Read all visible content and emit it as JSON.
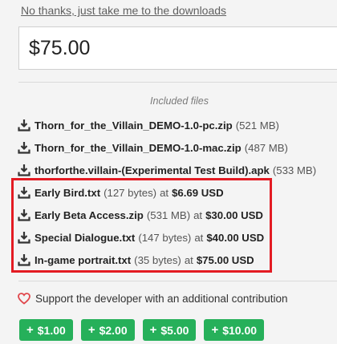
{
  "skip_link": "No thanks, just take me to the downloads",
  "price_input": {
    "value": "$75.00"
  },
  "files_heading": "Included files",
  "files": [
    {
      "name": "Thorn_for_the_Villain_DEMO-1.0-pc.zip",
      "size": "(521 MB)",
      "price_prefix": "",
      "price": ""
    },
    {
      "name": "Thorn_for_the_Villain_DEMO-1.0-mac.zip",
      "size": "(487 MB)",
      "price_prefix": "",
      "price": ""
    },
    {
      "name": "thorforthe.villain-(Experimental Test Build).apk",
      "size": "(533 MB)",
      "price_prefix": "",
      "price": ""
    },
    {
      "name": "Early Bird.txt",
      "size": "(127 bytes)",
      "price_prefix": "at",
      "price": "$6.69 USD"
    },
    {
      "name": "Early Beta Access.zip",
      "size": "(531 MB)",
      "price_prefix": "at",
      "price": "$30.00 USD"
    },
    {
      "name": "Special Dialogue.txt",
      "size": "(147 bytes)",
      "price_prefix": "at",
      "price": "$40.00 USD"
    },
    {
      "name": "In-game portrait.txt",
      "size": "(35 bytes)",
      "price_prefix": "at",
      "price": "$75.00 USD"
    }
  ],
  "support_text": "Support the developer with an additional contribution",
  "tip_buttons": [
    {
      "plus": "+",
      "label": "$1.00"
    },
    {
      "plus": "+",
      "label": "$2.00"
    },
    {
      "plus": "+",
      "label": "$5.00"
    },
    {
      "plus": "+",
      "label": "$10.00"
    }
  ],
  "icons": {
    "download": "download-icon",
    "heart": "heart-icon"
  },
  "colors": {
    "tip_button": "#26b05a",
    "highlight_border": "#e31b23",
    "heart": "#e0474c"
  }
}
